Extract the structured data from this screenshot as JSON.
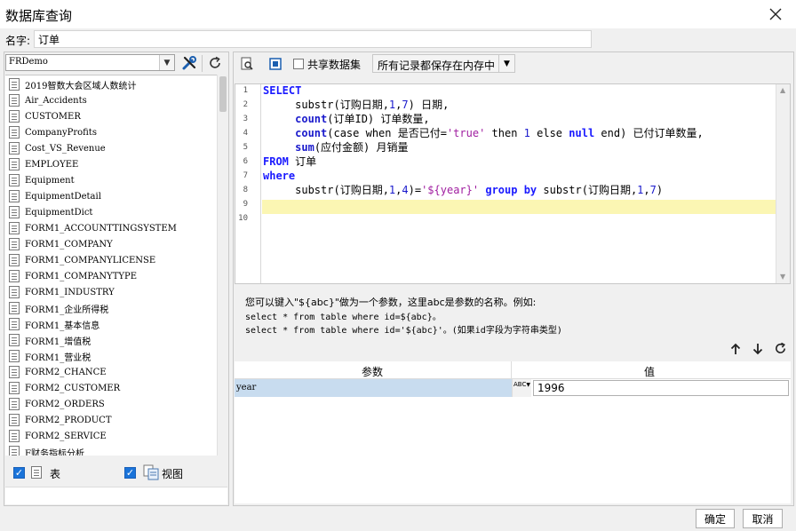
{
  "window": {
    "title": "数据库查询"
  },
  "name_row": {
    "label": "名字:",
    "value": "订单"
  },
  "connection": {
    "selected": "FRDemo"
  },
  "tables": [
    "2019智数大会区域人数统计",
    "Air_Accidents",
    "CUSTOMER",
    "CompanyProfits",
    "Cost_VS_Revenue",
    "EMPLOYEE",
    "Equipment",
    "EquipmentDetail",
    "EquipmentDict",
    "FORM1_ACCOUNTTINGSYSTEM",
    "FORM1_COMPANY",
    "FORM1_COMPANYLICENSE",
    "FORM1_COMPANYTYPE",
    "FORM1_INDUSTRY",
    "FORM1_企业所得税",
    "FORM1_基本信息",
    "FORM1_增值税",
    "FORM1_营业税",
    "FORM2_CHANCE",
    "FORM2_CUSTOMER",
    "FORM2_ORDERS",
    "FORM2_PRODUCT",
    "FORM2_SERVICE",
    "F财务指标分析"
  ],
  "filters": {
    "table_label": "表",
    "view_label": "视图"
  },
  "toolbar": {
    "share_label": "共享数据集",
    "storage_option": "所有记录都保存在内存中"
  },
  "editor": {
    "line_numbers": [
      "1",
      "2",
      "3",
      "4",
      "5",
      "6",
      "7",
      "8",
      "9",
      "10"
    ],
    "lines": {
      "l1": "SELECT",
      "l2a": "     substr(订购日期,",
      "l2b": "1",
      "l2c": ",",
      "l2d": "7",
      "l2e": ") 日期,",
      "l3a": "     ",
      "l3b": "count",
      "l3c": "(订单ID) 订单数量,",
      "l4a": "     ",
      "l4b": "count",
      "l4c": "(case when 是否已付=",
      "l4d": "'true'",
      "l4e": " then ",
      "l4f": "1",
      "l4g": " else ",
      "l4h": "null",
      "l4i": " end) 已付订单数量,",
      "l5a": "     ",
      "l5b": "sum",
      "l5c": "(应付金额) 月销量",
      "l6a": "FROM",
      "l6b": " 订单",
      "l7": "where",
      "l8a": "     substr(订购日期,",
      "l8b": "1",
      "l8c": ",",
      "l8d": "4",
      "l8e": ")=",
      "l8f": "'${year}'",
      "l8g": " ",
      "l8h": "group by",
      "l8i": " substr(订购日期,",
      "l8j": "1",
      "l8k": ",",
      "l8l": "7",
      "l8m": ")"
    }
  },
  "hint": {
    "line1": "您可以键入\"${abc}\"做为一个参数，这里abc是参数的名称。例如:",
    "line2": "select * from table where id=${abc}。",
    "line3": "select * from table where id='${abc}'。(如果id字段为字符串类型)"
  },
  "params": {
    "col_name": "参数",
    "col_value": "值",
    "rows": [
      {
        "name": "year",
        "type_label": "ABC",
        "value": "1996"
      }
    ]
  },
  "buttons": {
    "ok": "确定",
    "cancel": "取消"
  },
  "colors": {
    "accent": "#1a73d9",
    "keyword": "#1a1aff",
    "string": "#a01ea0",
    "highlight": "#fbf6b3",
    "selected_row": "#c8dcef"
  }
}
